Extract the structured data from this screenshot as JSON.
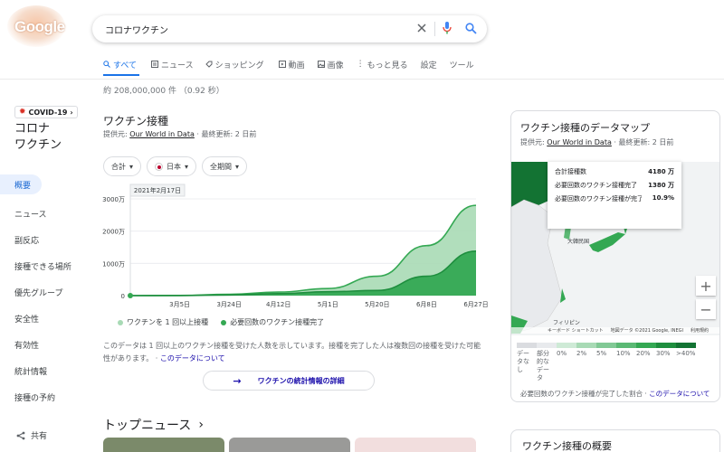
{
  "logo": "Google",
  "search": {
    "query": "コロナワクチン"
  },
  "tabs": [
    {
      "label": "すべて",
      "icon": "search-icon"
    },
    {
      "label": "ニュース",
      "icon": "news-icon"
    },
    {
      "label": "ショッピング",
      "icon": "tag-icon"
    },
    {
      "label": "動画",
      "icon": "play-icon"
    },
    {
      "label": "画像",
      "icon": "image-icon"
    },
    {
      "label": "もっと見る",
      "icon": "more-vert-icon"
    },
    {
      "label": "設定"
    },
    {
      "label": "ツール"
    }
  ],
  "results_count": "約 208,000,000 件 （0.92 秒）",
  "sidebar": {
    "badge": "COVID-19",
    "title_line1": "コロナ",
    "title_line2": "ワクチン",
    "items": [
      "概要",
      "ニュース",
      "副反応",
      "接種できる場所",
      "優先グループ",
      "安全性",
      "有効性",
      "統計情報",
      "接種の予約"
    ],
    "share": "共有"
  },
  "main": {
    "title": "ワクチン接種",
    "source_prefix": "提供元: ",
    "source_link": "Our World in Data",
    "source_suffix": " · 最終更新: 2 日前",
    "filters": [
      "合計",
      "日本",
      "全期間"
    ],
    "note_text": "このデータは 1 回以上のワクチン接種を受けた人数を示しています。接種を完了した人は複数回の接種を受けた可能性があります。",
    "note_link": "このデータについて",
    "detail_button": "ワクチンの統計情報の詳細",
    "news_title": "トップニュース"
  },
  "chart_data": {
    "type": "area",
    "tooltip_date": "2021年2月17日",
    "x": [
      "2月17日",
      "3月5日",
      "3月24日",
      "4月12日",
      "5月1日",
      "5月20日",
      "6月8日",
      "6月27日"
    ],
    "xticks": [
      "3月5日",
      "3月24日",
      "4月12日",
      "5月1日",
      "5月20日",
      "6月8日",
      "6月27日"
    ],
    "yticks": [
      "0",
      "1000万",
      "2000万",
      "3000万"
    ],
    "ylim": [
      0,
      3000
    ],
    "series": [
      {
        "name": "ワクチンを 1 回以上接種",
        "color": "#a8dab5",
        "values": [
          0,
          5,
          40,
          110,
          220,
          600,
          1550,
          2800
        ]
      },
      {
        "name": "必要回数のワクチン接種完了",
        "color": "#34a853",
        "values": [
          0,
          2,
          20,
          60,
          120,
          160,
          600,
          1380
        ]
      }
    ],
    "grid": true
  },
  "map_card": {
    "title": "ワクチン接種のデータマップ",
    "source_prefix": "提供元: ",
    "source_link": "Our World in Data",
    "source_suffix": " · 最終更新: 2 日前",
    "tooltip": [
      {
        "label": "合計接種数",
        "value": "4180",
        "unit": "万"
      },
      {
        "label": "必要回数のワクチン接種完了",
        "value": "1380",
        "unit": "万"
      },
      {
        "label": "必要回数のワクチン接種が完了した割合",
        "value": "10.9%",
        "unit": ""
      }
    ],
    "map_labels": [
      "大韓民国",
      "フィリピン"
    ],
    "attribution": [
      "キーボード ショートカット",
      "地図データ ©2021 Google, INEGI",
      "利用規約"
    ],
    "scale": [
      {
        "label": "データなし",
        "color": "#dadce0"
      },
      {
        "label": "部分的なデータ",
        "color": "#e8eaed"
      },
      {
        "label": "0%",
        "color": "#ceead6"
      },
      {
        "label": "2%",
        "color": "#a8dab5"
      },
      {
        "label": "5%",
        "color": "#81c995"
      },
      {
        "label": "10%",
        "color": "#5bb974"
      },
      {
        "label": "20%",
        "color": "#34a853"
      },
      {
        "label": "30%",
        "color": "#1e8e3e"
      },
      {
        "label": ">40%",
        "color": "#137333"
      }
    ],
    "footer_text": "必要回数のワクチン接種が完了した割合 · ",
    "footer_link": "このデータについて"
  },
  "card2_title": "ワクチン接種の概要"
}
